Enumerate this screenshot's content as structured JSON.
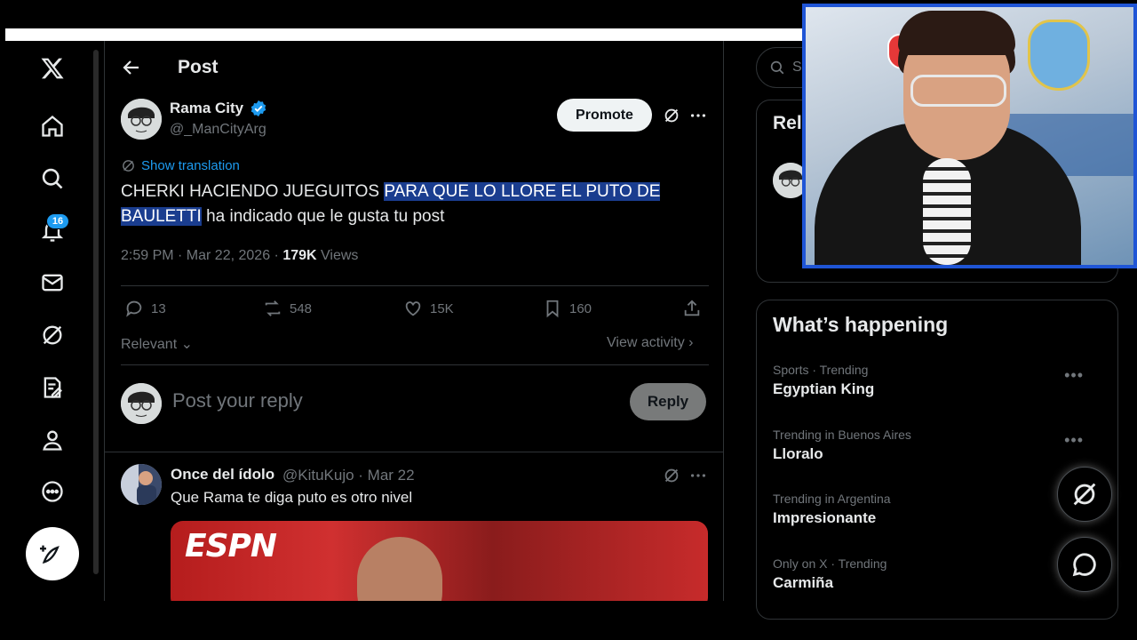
{
  "nav": {
    "notification_count": "16"
  },
  "post": {
    "header_title": "Post",
    "author_name": "Rama City",
    "author_handle": "@_ManCityArg",
    "promote_label": "Promote",
    "show_translation": "Show translation",
    "text_plain_start": "CHERKI HACIENDO JUEGUITOS ",
    "text_highlighted": "PARA QUE LO LLORE EL PUTO DE BAULETTI",
    "text_plain_end": " ha indicado que le gusta tu post",
    "time": "2:59 PM · Mar 22, 2026 · ",
    "views_count": "179K",
    "views_label": " Views",
    "stats": {
      "replies": "13",
      "reposts": "548",
      "likes": "15K",
      "bookmarks": "160"
    },
    "sort_label": "Relevant",
    "view_activity": "View activity"
  },
  "composer": {
    "placeholder": "Post your reply",
    "reply_label": "Reply"
  },
  "reply": {
    "name": "Once del ídolo",
    "handle_date": "@KituKujo · Mar 22",
    "text": "Que Rama te diga puto es otro nivel",
    "media_logo": "ESPN"
  },
  "sidebar": {
    "search_placeholder": "Se",
    "relevant_title": "Rel",
    "happening_title": "What’s happening",
    "trends": [
      {
        "context": "Sports · Trending",
        "name": "Egyptian King"
      },
      {
        "context": "Trending in Buenos Aires",
        "name": "Lloralo"
      },
      {
        "context": "Trending in Argentina",
        "name": "Impresionante"
      },
      {
        "context": "Only on X · Trending",
        "name": "Carmiña"
      }
    ]
  },
  "colors": {
    "accent": "#1d9bf0",
    "highlight": "#1a3d8f",
    "border": "#2f3336",
    "muted": "#71767b",
    "cam_border": "#1f55d6"
  }
}
